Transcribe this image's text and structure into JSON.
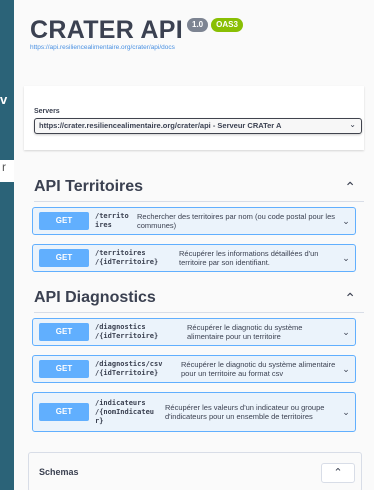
{
  "background_peek": {
    "heading_fragment": "v",
    "input_fragment": "r"
  },
  "header": {
    "title": "CRATER API",
    "version_badge": "1.0",
    "oas_badge": "OAS3",
    "docs_url": "https://api.resiliencealimentaire.org/crater/api/docs"
  },
  "servers": {
    "label": "Servers",
    "selected": "https://crater.resiliencealimentaire.org/crater/api - Serveur CRATer A"
  },
  "sections": [
    {
      "title": "API Territoires",
      "operations": [
        {
          "method": "GET",
          "path": "/territo\nires",
          "summary": "Rechercher des territoires par nom (ou code postal pour les communes)"
        },
        {
          "method": "GET",
          "path": "/territoires\n/{idTerritoire}",
          "summary": "Récupérer les informations détaillées d'un territoire par son identifiant."
        }
      ]
    },
    {
      "title": "API Diagnostics",
      "operations": [
        {
          "method": "GET",
          "path": "/diagnostics\n/{idTerritoire}",
          "summary": "Récupérer le diagnotic du système alimentaire pour un territoire"
        },
        {
          "method": "GET",
          "path": "/diagnostics/csv\n/{idTerritoire}",
          "summary": "Récupérer le diagnotic du système alimentaire pour un territoire au format csv"
        },
        {
          "method": "GET",
          "path": "/indicateurs\n/{nomIndicateu\nr}",
          "summary": "Récupérer les valeurs d'un indicateur ou groupe d'indicateurs pour un ensemble de territoires"
        }
      ]
    }
  ],
  "schemas": {
    "title": "Schemas"
  },
  "icons": {
    "collapse": "chevron-up-icon",
    "expand": "chevron-down-icon",
    "select": "chevron-down-icon"
  },
  "colors": {
    "get_method": "#61affe",
    "get_background": "#ebf3fb",
    "oas_badge": "#89bf04",
    "version_badge": "#7d8492",
    "link": "#4990e2"
  }
}
